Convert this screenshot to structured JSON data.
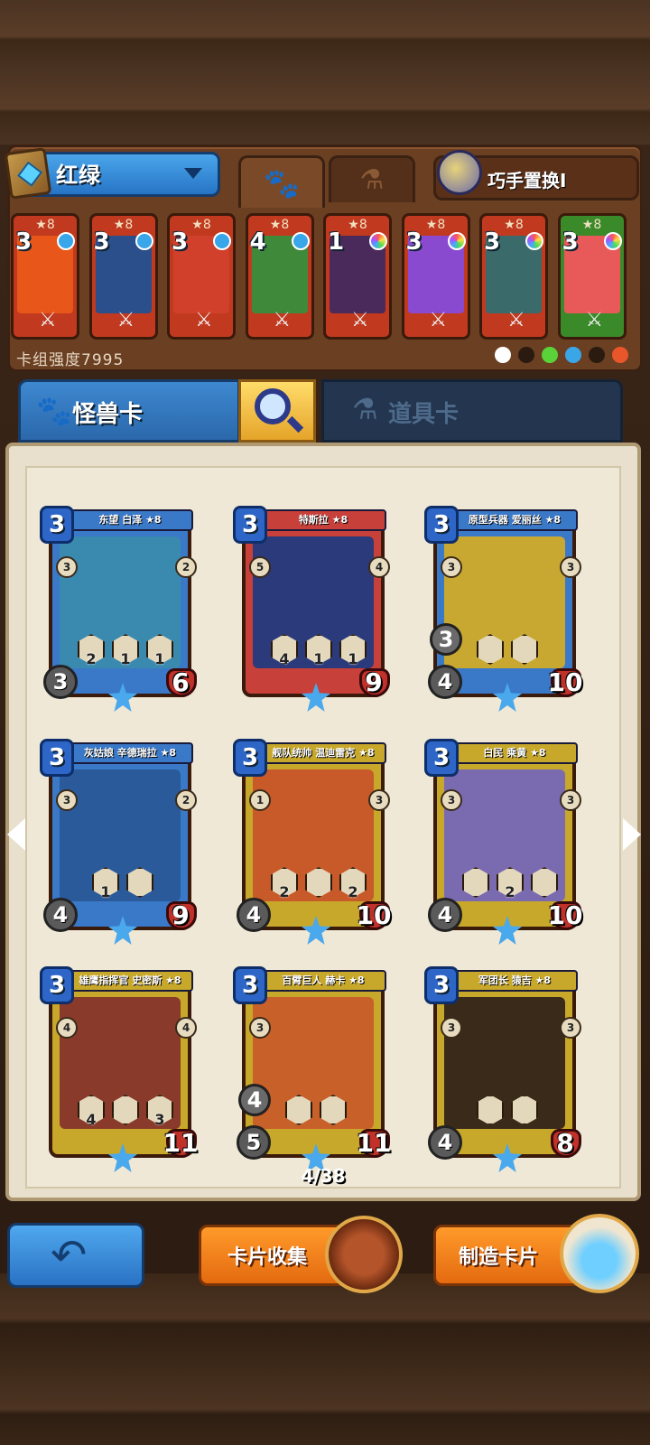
{
  "deck": {
    "name": "红绿",
    "power_label": "卡组强度7995",
    "swap_label": "巧手置换I",
    "cards": [
      {
        "cost": "3",
        "stars": "★8",
        "color": "#c1391f",
        "art": "#e8561a",
        "gem": "blue"
      },
      {
        "cost": "3",
        "stars": "★8",
        "color": "#c1391f",
        "art": "#2a4f8a",
        "gem": "blue"
      },
      {
        "cost": "3",
        "stars": "★8",
        "color": "#c1391f",
        "art": "#d0402a",
        "gem": "blue"
      },
      {
        "cost": "4",
        "stars": "★8",
        "color": "#c1391f",
        "art": "#3f8a3a",
        "gem": "blue"
      },
      {
        "cost": "1",
        "stars": "★8",
        "color": "#c1391f",
        "art": "#4a2a5a",
        "gem": "rainbow"
      },
      {
        "cost": "3",
        "stars": "★8",
        "color": "#c1391f",
        "art": "#8a4ad0",
        "gem": "rainbow"
      },
      {
        "cost": "3",
        "stars": "★8",
        "color": "#c1391f",
        "art": "#3a6a6a",
        "gem": "rainbow"
      },
      {
        "cost": "3",
        "stars": "★8",
        "color": "#3a8a2a",
        "art": "#e85a5a",
        "gem": "rainbow"
      }
    ],
    "elements": [
      "#ffffff",
      "#2a1a10",
      "#5ad23a",
      "#3aa6e8",
      "#2a1a10",
      "#e8562a"
    ]
  },
  "tabs": {
    "monster_label": "怪兽卡",
    "item_label": "道具卡"
  },
  "collection": {
    "counter": "4/38",
    "cards": [
      {
        "name": "东望 白泽 ★8",
        "cost": "3",
        "atk": "3",
        "hp": "6",
        "left": "3",
        "right": "2",
        "skills": [
          "2",
          "1",
          "1"
        ],
        "frame": "#3a78c8",
        "art": "#3a8ab0",
        "extra": ""
      },
      {
        "name": "特斯拉 ★8",
        "cost": "3",
        "atk": "",
        "hp": "9",
        "left": "5",
        "right": "4",
        "skills": [
          "4",
          "1",
          "1"
        ],
        "frame": "#c8403a",
        "art": "#2a3a7a",
        "extra": ""
      },
      {
        "name": "原型兵器 爱丽丝 ★8",
        "cost": "3",
        "atk": "4",
        "hp": "10",
        "left": "3",
        "right": "3",
        "skills": [
          "",
          ""
        ],
        "frame": "#3a78c8",
        "art": "#c8a830",
        "extra": "3"
      },
      {
        "name": "灰姑娘 辛德瑞拉 ★8",
        "cost": "3",
        "atk": "4",
        "hp": "9",
        "left": "3",
        "right": "2",
        "skills": [
          "1",
          ""
        ],
        "frame": "#3a78c8",
        "art": "#2a5a9a",
        "extra": ""
      },
      {
        "name": "舰队统帅 温迪雷克 ★8",
        "cost": "3",
        "atk": "4",
        "hp": "10",
        "left": "1",
        "right": "3",
        "skills": [
          "2",
          "",
          "2"
        ],
        "frame": "#c8a82a",
        "art": "#c85a2a",
        "extra": ""
      },
      {
        "name": "白民 乘黄 ★8",
        "cost": "3",
        "atk": "4",
        "hp": "10",
        "left": "3",
        "right": "3",
        "skills": [
          "",
          "2",
          ""
        ],
        "frame": "#c8a82a",
        "art": "#7a6ab0",
        "extra": ""
      },
      {
        "name": "雄鹰指挥官 史密斯 ★8",
        "cost": "3",
        "atk": "",
        "hp": "11",
        "left": "4",
        "right": "4",
        "skills": [
          "4",
          "",
          "3"
        ],
        "frame": "#c8a82a",
        "art": "#8a3a2a",
        "extra": ""
      },
      {
        "name": "百臂巨人 赫卡 ★8",
        "cost": "3",
        "atk": "5",
        "hp": "11",
        "left": "3",
        "right": "",
        "skills": [
          "",
          ""
        ],
        "frame": "#c8a82a",
        "art": "#c8602a",
        "extra": "4"
      },
      {
        "name": "军团长 猿吉 ★8",
        "cost": "3",
        "atk": "4",
        "hp": "8",
        "left": "3",
        "right": "3",
        "skills": [
          "",
          ""
        ],
        "frame": "#c8a82a",
        "art": "#3a2a1a",
        "extra": ""
      }
    ]
  },
  "buttons": {
    "collect_label": "卡片收集",
    "craft_label": "制造卡片"
  }
}
